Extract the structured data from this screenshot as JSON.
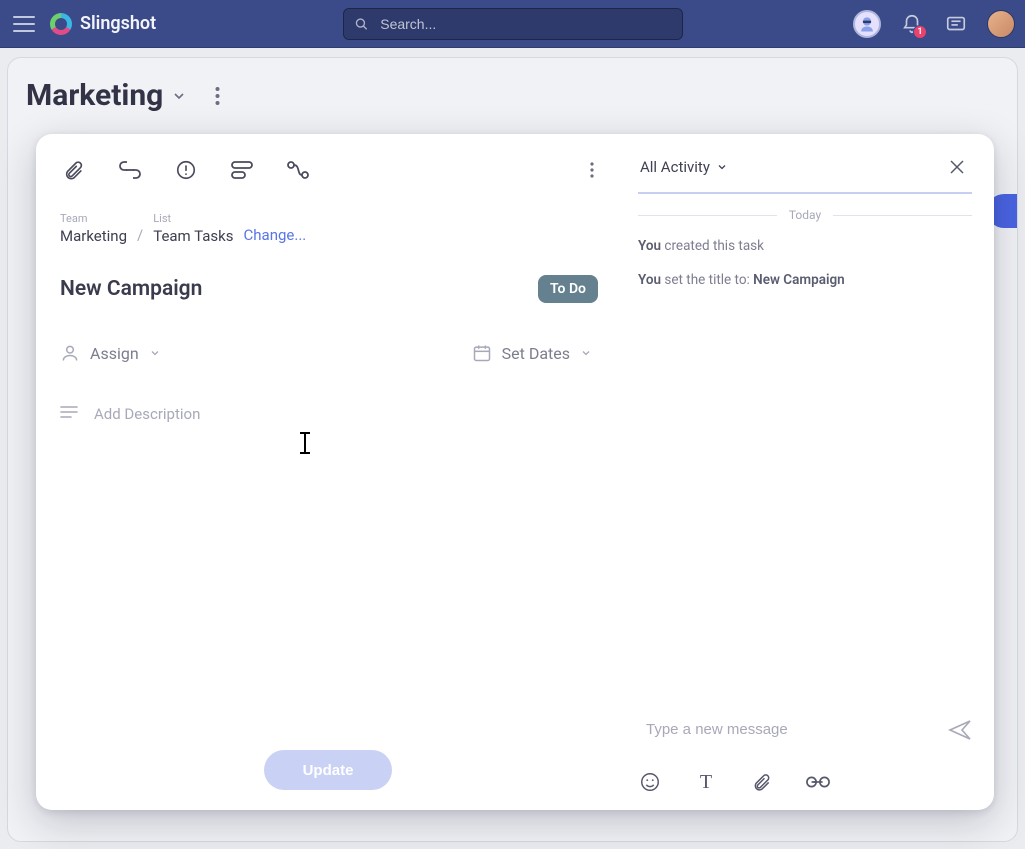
{
  "header": {
    "brand": "Slingshot",
    "search_placeholder": "Search...",
    "notification_count": "1"
  },
  "page": {
    "title": "Marketing"
  },
  "task": {
    "breadcrumb": {
      "team_label": "Team",
      "team_value": "Marketing",
      "list_label": "List",
      "list_value": "Team Tasks",
      "change_label": "Change..."
    },
    "title": "New Campaign",
    "status": "To Do",
    "assign_label": "Assign",
    "dates_label": "Set Dates",
    "description_placeholder": "Add Description",
    "update_button": "Update"
  },
  "activity": {
    "tab_label": "All Activity",
    "day_label": "Today",
    "entries": [
      {
        "actor": "You",
        "text": " created this task"
      },
      {
        "actor": "You",
        "text": " set the title to: ",
        "value": "New Campaign"
      }
    ],
    "compose_placeholder": "Type a new message"
  }
}
